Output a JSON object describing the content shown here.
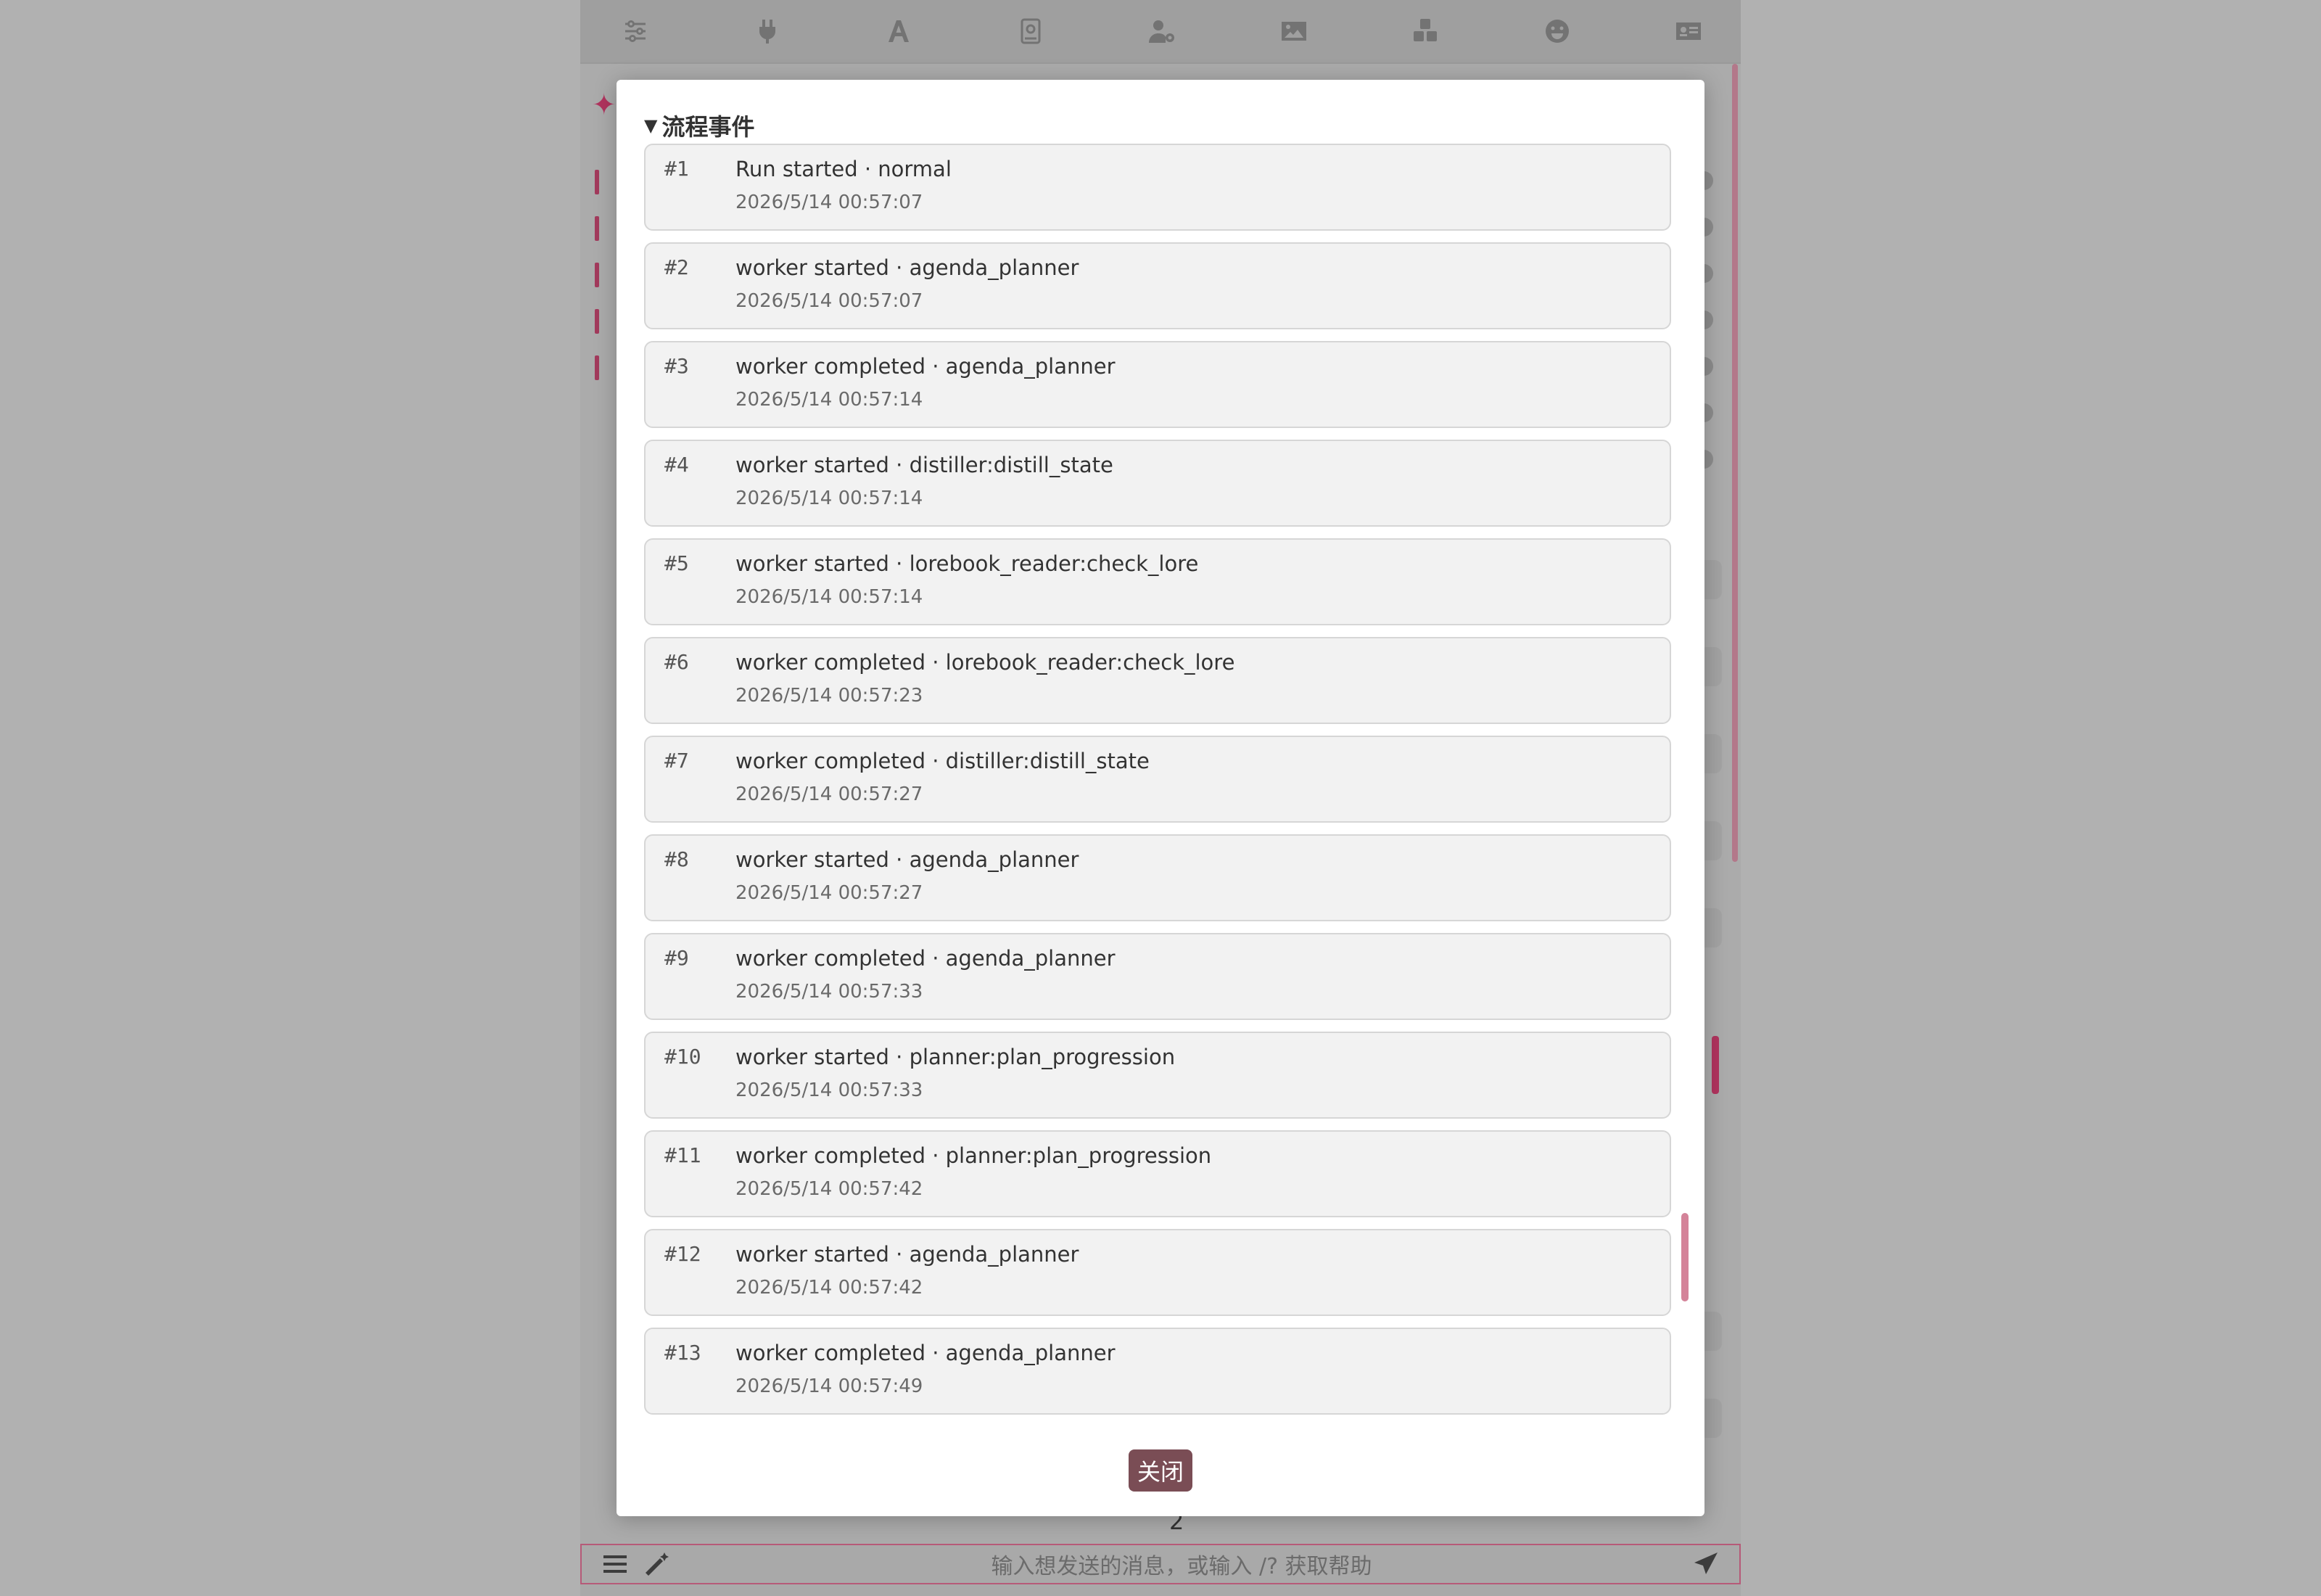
{
  "toolbar": {
    "icons": [
      "sliders-icon",
      "plug-icon",
      "font-icon",
      "book-icon",
      "user-cog-icon",
      "image-icon",
      "cubes-icon",
      "smile-icon",
      "id-card-icon"
    ]
  },
  "background": {
    "input_placeholder": "输入想发送的消息，或输入 /? 获取帮助",
    "page_number": "2",
    "accent_color": "#b0345e"
  },
  "modal": {
    "section_title": "流程事件",
    "close_label": "关闭",
    "close_color": "#7a4d55",
    "events": [
      {
        "index": "#1",
        "title": "Run started · normal",
        "time": "2026/5/14 00:57:07"
      },
      {
        "index": "#2",
        "title": "worker started · agenda_planner",
        "time": "2026/5/14 00:57:07"
      },
      {
        "index": "#3",
        "title": "worker completed · agenda_planner",
        "time": "2026/5/14 00:57:14"
      },
      {
        "index": "#4",
        "title": "worker started · distiller:distill_state",
        "time": "2026/5/14 00:57:14"
      },
      {
        "index": "#5",
        "title": "worker started · lorebook_reader:check_lore",
        "time": "2026/5/14 00:57:14"
      },
      {
        "index": "#6",
        "title": "worker completed · lorebook_reader:check_lore",
        "time": "2026/5/14 00:57:23"
      },
      {
        "index": "#7",
        "title": "worker completed · distiller:distill_state",
        "time": "2026/5/14 00:57:27"
      },
      {
        "index": "#8",
        "title": "worker started · agenda_planner",
        "time": "2026/5/14 00:57:27"
      },
      {
        "index": "#9",
        "title": "worker completed · agenda_planner",
        "time": "2026/5/14 00:57:33"
      },
      {
        "index": "#10",
        "title": "worker started · planner:plan_progression",
        "time": "2026/5/14 00:57:33"
      },
      {
        "index": "#11",
        "title": "worker completed · planner:plan_progression",
        "time": "2026/5/14 00:57:42"
      },
      {
        "index": "#12",
        "title": "worker started · agenda_planner",
        "time": "2026/5/14 00:57:42"
      },
      {
        "index": "#13",
        "title": "worker completed · agenda_planner",
        "time": "2026/5/14 00:57:49"
      }
    ]
  }
}
